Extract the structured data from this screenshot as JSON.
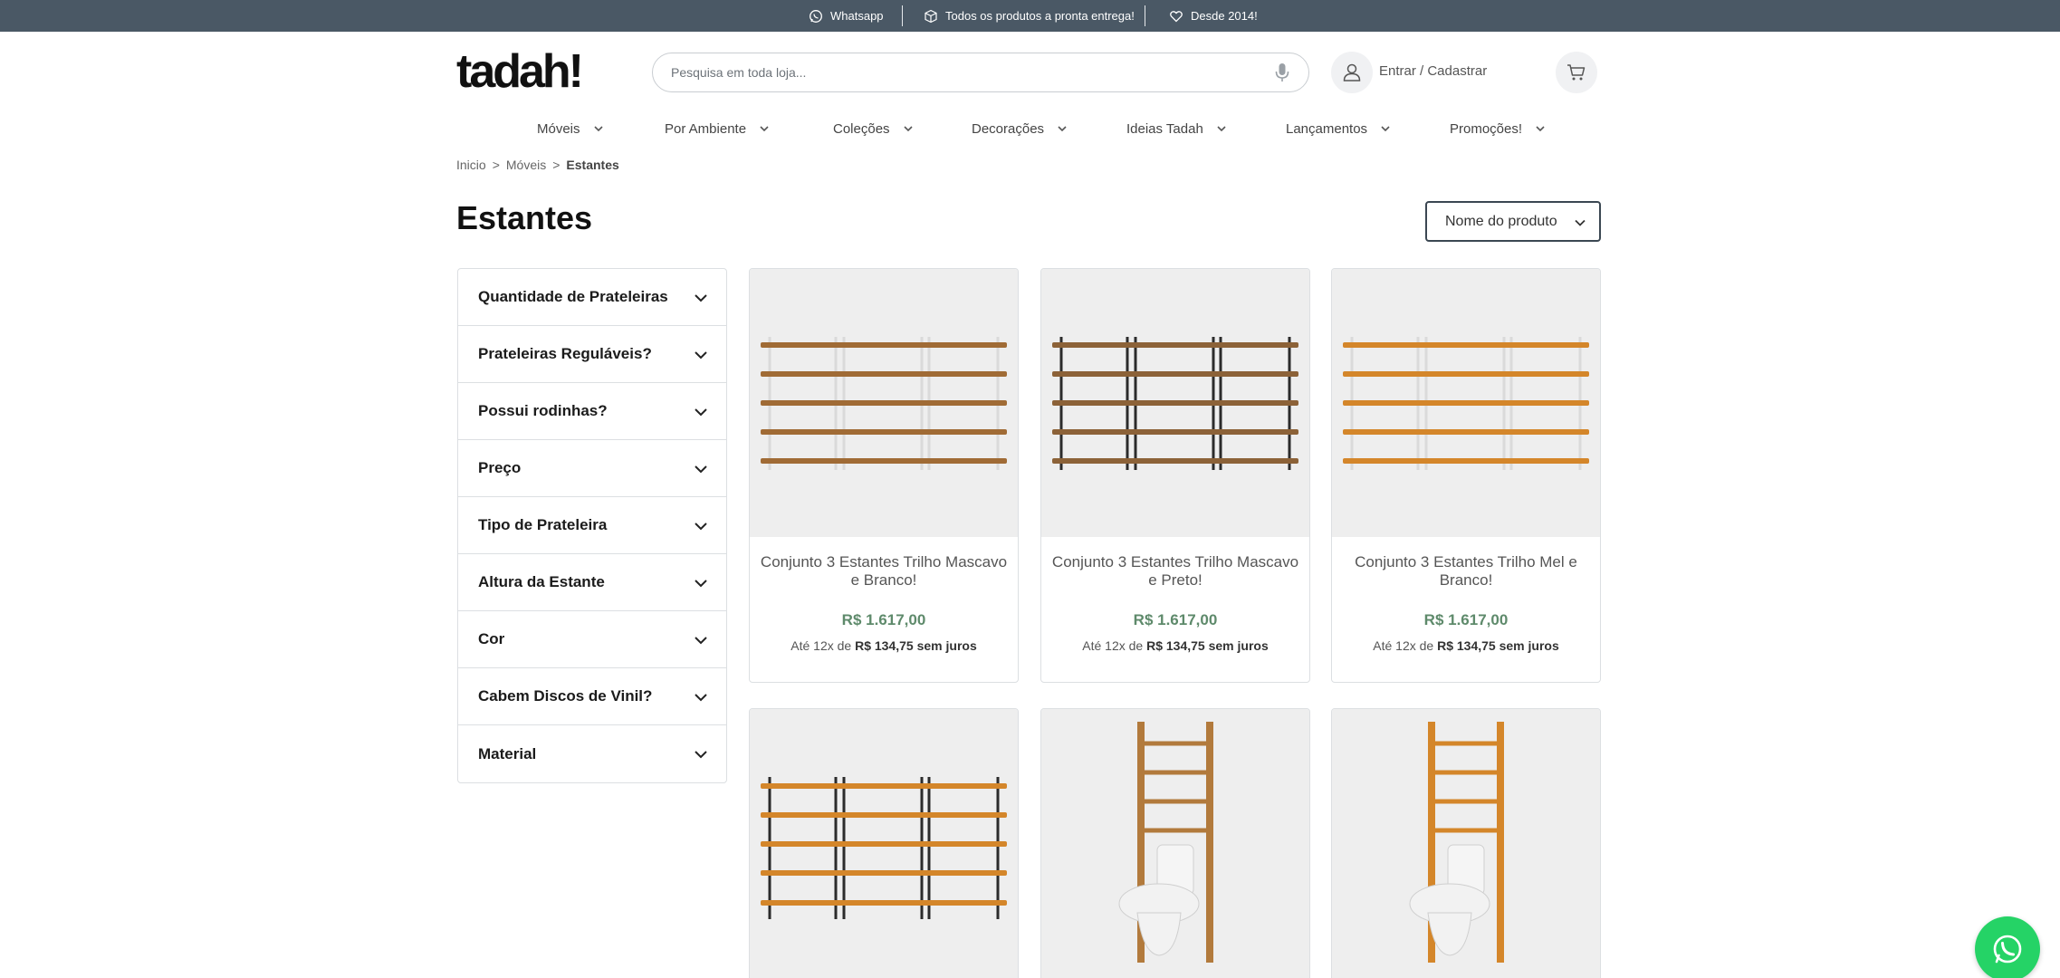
{
  "topbar": {
    "items": [
      {
        "label": "Whatsapp",
        "icon": "whatsapp-icon"
      },
      {
        "label": "Todos os produtos a pronta entrega!",
        "icon": "box-icon"
      },
      {
        "label": "Desde 2014!",
        "icon": "heart-icon"
      }
    ],
    "background": "#4a5865"
  },
  "header": {
    "logo_text": "tadah!",
    "search_placeholder": "Pesquisa em toda loja...",
    "login_label": "Entrar / Cadastrar"
  },
  "nav": {
    "items": [
      {
        "label": "Móveis"
      },
      {
        "label": "Por Ambiente"
      },
      {
        "label": "Coleções"
      },
      {
        "label": "Decorações"
      },
      {
        "label": "Ideias Tadah"
      },
      {
        "label": "Lançamentos"
      },
      {
        "label": "Promoções!"
      }
    ]
  },
  "breadcrumb": {
    "items": [
      "Inicio",
      "Móveis",
      "Estantes"
    ],
    "separator": ">"
  },
  "page": {
    "title": "Estantes",
    "sort_selected": "Nome do produto"
  },
  "filters": {
    "items": [
      "Quantidade de Prateleiras",
      "Prateleiras Reguláveis?",
      "Possui rodinhas?",
      "Preço",
      "Tipo de Prateleira",
      "Altura da Estante",
      "Cor",
      "Cabem Discos de Vinil?",
      "Material"
    ]
  },
  "products": [
    {
      "name": "Conjunto 3 Estantes Trilho Mascavo e Branco!",
      "price": "R$ 1.617,00",
      "installment_prefix": "Até 12x de",
      "installment_value": "R$ 134,75 sem juros"
    },
    {
      "name": "Conjunto 3 Estantes Trilho Mascavo e Preto!",
      "price": "R$ 1.617,00",
      "installment_prefix": "Até 12x de",
      "installment_value": "R$ 134,75 sem juros"
    },
    {
      "name": "Conjunto 3 Estantes Trilho Mel e Branco!",
      "price": "R$ 1.617,00",
      "installment_prefix": "Até 12x de",
      "installment_value": "R$ 134,75 sem juros"
    },
    {
      "name": "",
      "price": "",
      "installment_prefix": "",
      "installment_value": ""
    },
    {
      "name": "",
      "price": "",
      "installment_prefix": "",
      "installment_value": ""
    },
    {
      "name": "",
      "price": "",
      "installment_prefix": "",
      "installment_value": ""
    }
  ],
  "colors": {
    "price": "#5e8a6b",
    "whatsapp": "#25d366",
    "wood_mascavo": "#a06b35",
    "wood_mel": "#d4862a"
  }
}
